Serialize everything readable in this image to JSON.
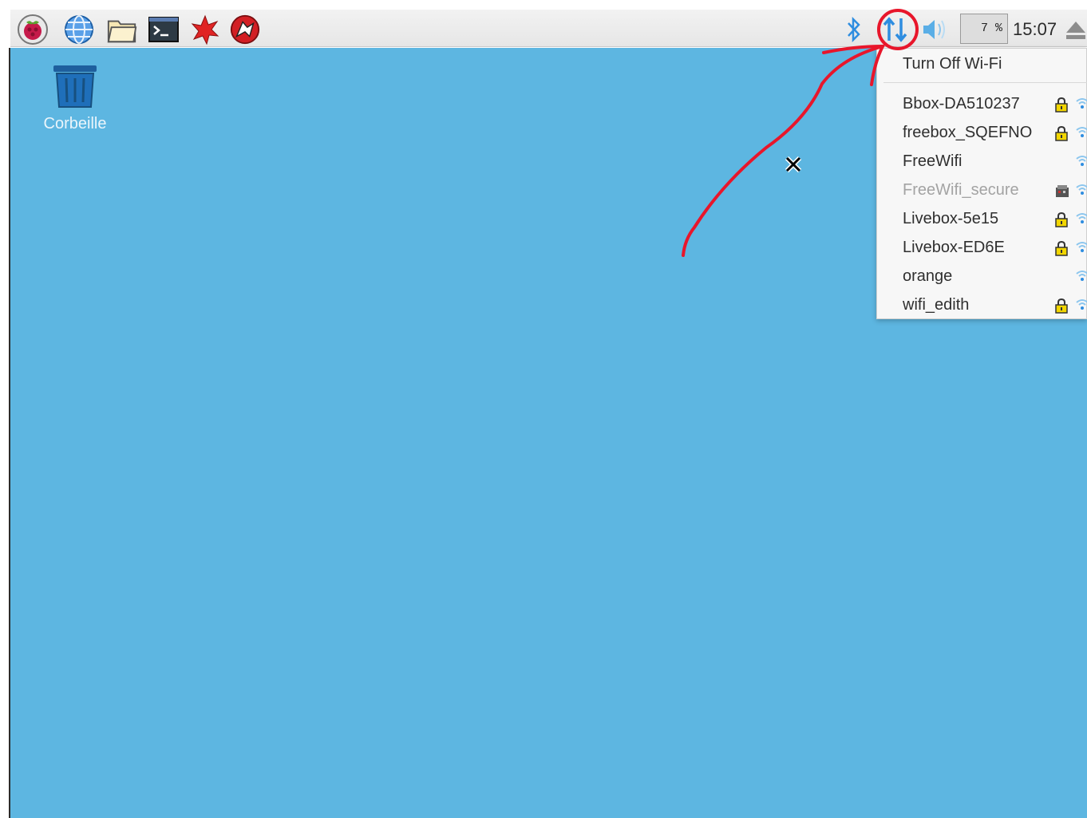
{
  "taskbar": {
    "launchers": [
      {
        "name": "raspberry-menu-icon"
      },
      {
        "name": "web-browser-icon"
      },
      {
        "name": "file-manager-icon"
      },
      {
        "name": "terminal-icon"
      },
      {
        "name": "mathematica-icon"
      },
      {
        "name": "wolfram-icon"
      }
    ],
    "tray": {
      "bluetooth_icon": "bluetooth-icon",
      "network_icon": "network-updown-icon",
      "volume_icon": "volume-icon",
      "cpu_usage": "7 %",
      "clock": "15:07",
      "eject_icon": "eject-icon"
    }
  },
  "desktop": {
    "background_color": "#5db6e1",
    "icons": [
      {
        "label": "Corbeille",
        "icon": "trash-icon"
      }
    ]
  },
  "network_menu": {
    "toggle_label": "Turn Off Wi-Fi",
    "networks": [
      {
        "ssid": "Bbox-DA510237",
        "secured": true,
        "disabled": false
      },
      {
        "ssid": "freebox_SQEFNO",
        "secured": true,
        "disabled": false
      },
      {
        "ssid": "FreeWifi",
        "secured": false,
        "disabled": false
      },
      {
        "ssid": "FreeWifi_secure",
        "secured": true,
        "disabled": true
      },
      {
        "ssid": "Livebox-5e15",
        "secured": true,
        "disabled": false
      },
      {
        "ssid": "Livebox-ED6E",
        "secured": true,
        "disabled": false
      },
      {
        "ssid": "orange",
        "secured": false,
        "disabled": false
      },
      {
        "ssid": "wifi_edith",
        "secured": true,
        "disabled": false
      }
    ]
  },
  "colors": {
    "annotation_red": "#e8162b",
    "tray_blue": "#2e8de0",
    "lock_yellow": "#f2d600"
  }
}
